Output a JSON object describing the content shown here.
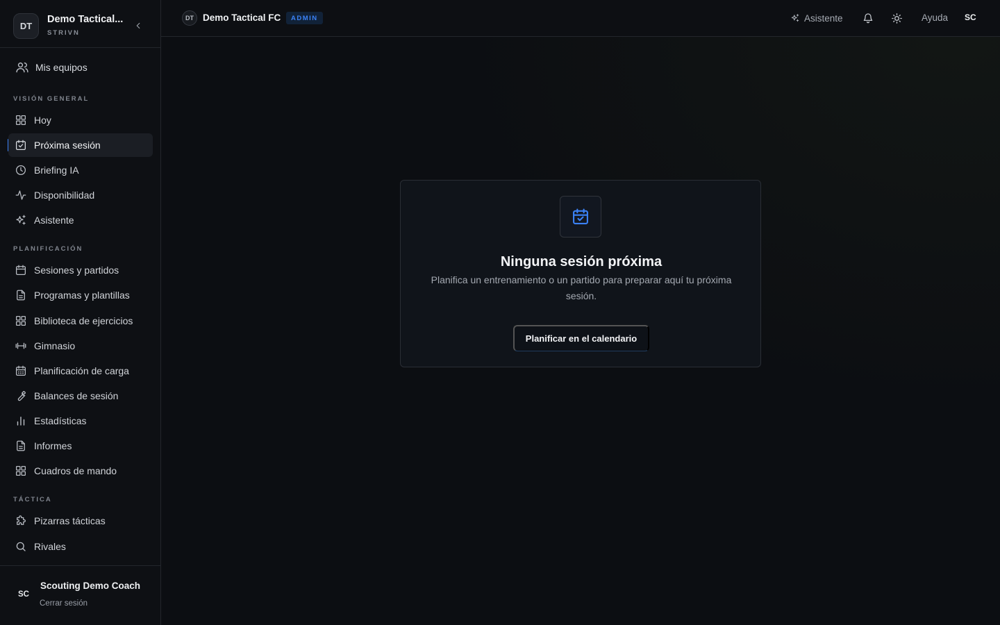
{
  "sidebar": {
    "brand_initials": "DT",
    "brand_title": "Demo Tactical...",
    "brand_subtitle": "STRIVN",
    "my_teams": "Mis equipos",
    "sections": [
      {
        "title": "VISIÓN GENERAL"
      },
      {
        "title": "PLANIFICACIÓN"
      },
      {
        "title": "TÁCTICA"
      }
    ],
    "items": [
      {
        "label": "Hoy",
        "icon": "grid-icon"
      },
      {
        "label": "Próxima sesión",
        "icon": "calendar-check-icon",
        "active": true
      },
      {
        "label": "Briefing IA",
        "icon": "clock-icon"
      },
      {
        "label": "Disponibilidad",
        "icon": "activity-icon"
      },
      {
        "label": "Asistente",
        "icon": "sparkles-icon"
      },
      {
        "label": "Sesiones y partidos",
        "icon": "calendar-icon"
      },
      {
        "label": "Programas y plantillas",
        "icon": "document-icon"
      },
      {
        "label": "Biblioteca de ejercicios",
        "icon": "grid-icon"
      },
      {
        "label": "Gimnasio",
        "icon": "dumbbell-icon"
      },
      {
        "label": "Planificación de carga",
        "icon": "calendar-grid-icon"
      },
      {
        "label": "Balances de sesión",
        "icon": "wrench-icon"
      },
      {
        "label": "Estadísticas",
        "icon": "bar-chart-icon"
      },
      {
        "label": "Informes",
        "icon": "document-icon"
      },
      {
        "label": "Cuadros de mando",
        "icon": "grid-icon"
      },
      {
        "label": "Pizarras tácticas",
        "icon": "puzzle-icon"
      },
      {
        "label": "Rivales",
        "icon": "search-icon"
      }
    ],
    "user_initials": "SC",
    "user_name": "Scouting Demo Coach",
    "logout": "Cerrar sesión"
  },
  "topbar": {
    "team_initials": "DT",
    "team_name": "Demo Tactical FC",
    "role_badge": "ADMIN",
    "assistant": "Asistente",
    "help": "Ayuda",
    "user_initials": "SC"
  },
  "empty_state": {
    "title": "Ninguna sesión próxima",
    "description": "Planifica un entrenamiento o un partido para preparar aquí tu próxima sesión.",
    "button": "Planificar en el calendario"
  },
  "colors": {
    "accent": "#3b82f6",
    "background": "#0c0e12",
    "sidebar": "#0e1014"
  }
}
